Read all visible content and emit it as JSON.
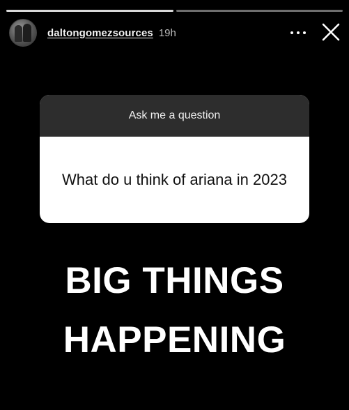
{
  "story": {
    "progress_segments": [
      {
        "state": "viewed"
      },
      {
        "state": "current"
      }
    ],
    "header": {
      "username": "daltongomezsources",
      "timestamp": "19h",
      "more_icon": "more-horizontal-icon",
      "close_icon": "close-icon"
    },
    "question_sticker": {
      "title": "Ask me a question",
      "question": "What do u think of ariana in 2023"
    },
    "answer_text": {
      "line1": "BIG THINGS",
      "line2": "HAPPENING"
    }
  },
  "colors": {
    "background": "#000000",
    "sticker_header": "#2d2d2d",
    "sticker_body": "#ffffff",
    "text_primary": "#ffffff"
  }
}
